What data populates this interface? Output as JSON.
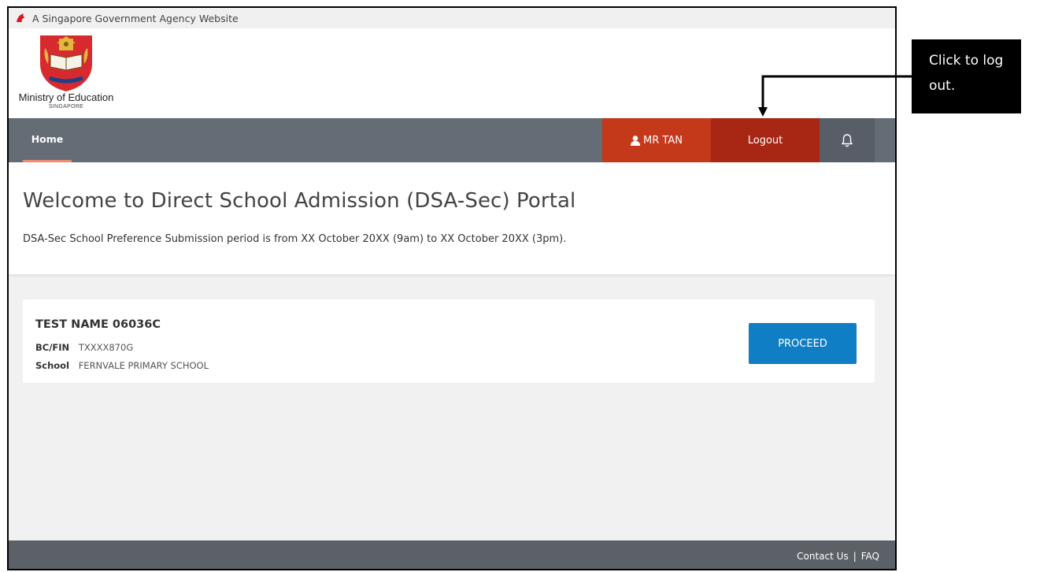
{
  "gov_banner": "A Singapore Government Agency Website",
  "agency": {
    "name": "Ministry of Education",
    "sub": "SINGAPORE"
  },
  "nav": {
    "home": "Home",
    "user": "MR TAN",
    "logout": "Logout",
    "bell_icon": "bell-icon",
    "user_icon": "user-icon"
  },
  "welcome": {
    "title": "Welcome to Direct School Admission (DSA-Sec) Portal",
    "period": "DSA-Sec School Preference Submission period is from XX October 20XX (9am) to XX October 20XX (3pm)."
  },
  "student": {
    "name": "TEST NAME 06036C",
    "bcfin_label": "BC/FIN",
    "bcfin": "TXXXX870G",
    "school_label": "School",
    "school": "FERNVALE PRIMARY SCHOOL",
    "proceed": "PROCEED"
  },
  "footer": {
    "contact": "Contact Us",
    "separator": "|",
    "faq": "FAQ"
  },
  "annotation": {
    "line1": "Click to log",
    "line2": "out."
  },
  "colors": {
    "nav_bg": "#646c75",
    "user_bg": "#c5391b",
    "logout_bg": "#a82714",
    "proceed_bg": "#0f7ec4",
    "footer_bg": "#5b6167"
  }
}
